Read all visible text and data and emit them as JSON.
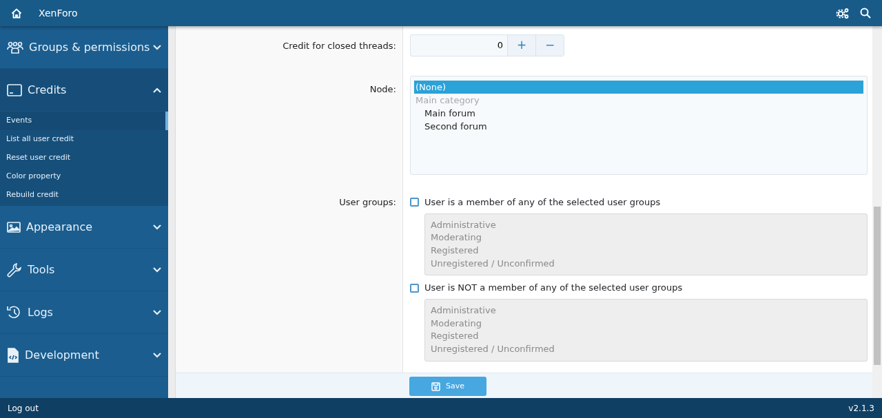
{
  "header": {
    "title": "XenForo"
  },
  "sidebar": {
    "sections": [
      {
        "label": "Groups & permissions",
        "expanded": false
      },
      {
        "label": "Credits",
        "expanded": true,
        "items": [
          {
            "label": "Events",
            "selected": true
          },
          {
            "label": "List all user credit",
            "selected": false
          },
          {
            "label": "Reset user credit",
            "selected": false
          },
          {
            "label": "Color property",
            "selected": false
          },
          {
            "label": "Rebuild credit",
            "selected": false
          }
        ]
      },
      {
        "label": "Appearance",
        "expanded": false
      },
      {
        "label": "Tools",
        "expanded": false
      },
      {
        "label": "Logs",
        "expanded": false
      },
      {
        "label": "Development",
        "expanded": false
      }
    ]
  },
  "form": {
    "rows": [
      {
        "kind": "spinbox",
        "label": "Credit for closed threads:",
        "value": "0",
        "buttons": [
          "+",
          "−"
        ]
      },
      {
        "kind": "listbox",
        "label": "Node:",
        "options": [
          {
            "label": "(None)",
            "selected": true,
            "disabled": false
          },
          {
            "label": "Main category",
            "selected": false,
            "disabled": true,
            "children": [
              {
                "label": "Main forum",
                "selected": false,
                "disabled": false
              },
              {
                "label": "Second forum",
                "selected": false,
                "disabled": false
              }
            ]
          }
        ]
      },
      {
        "kind": "checkgroups",
        "label": "User groups:",
        "choices": [
          {
            "label": "User is a member of any of the selected user groups",
            "checked": false,
            "disabled": true,
            "groups": [
              "Administrative",
              "Moderating",
              "Registered",
              "Unregistered / Unconfirmed"
            ]
          },
          {
            "label": "User is NOT a member of any of the selected user groups",
            "checked": false,
            "disabled": true,
            "groups": [
              "Administrative",
              "Moderating",
              "Registered",
              "Unregistered / Unconfirmed"
            ]
          }
        ]
      }
    ],
    "submit": "Save"
  },
  "footer": {
    "logout": "Log out",
    "version": "v2.1.3"
  }
}
